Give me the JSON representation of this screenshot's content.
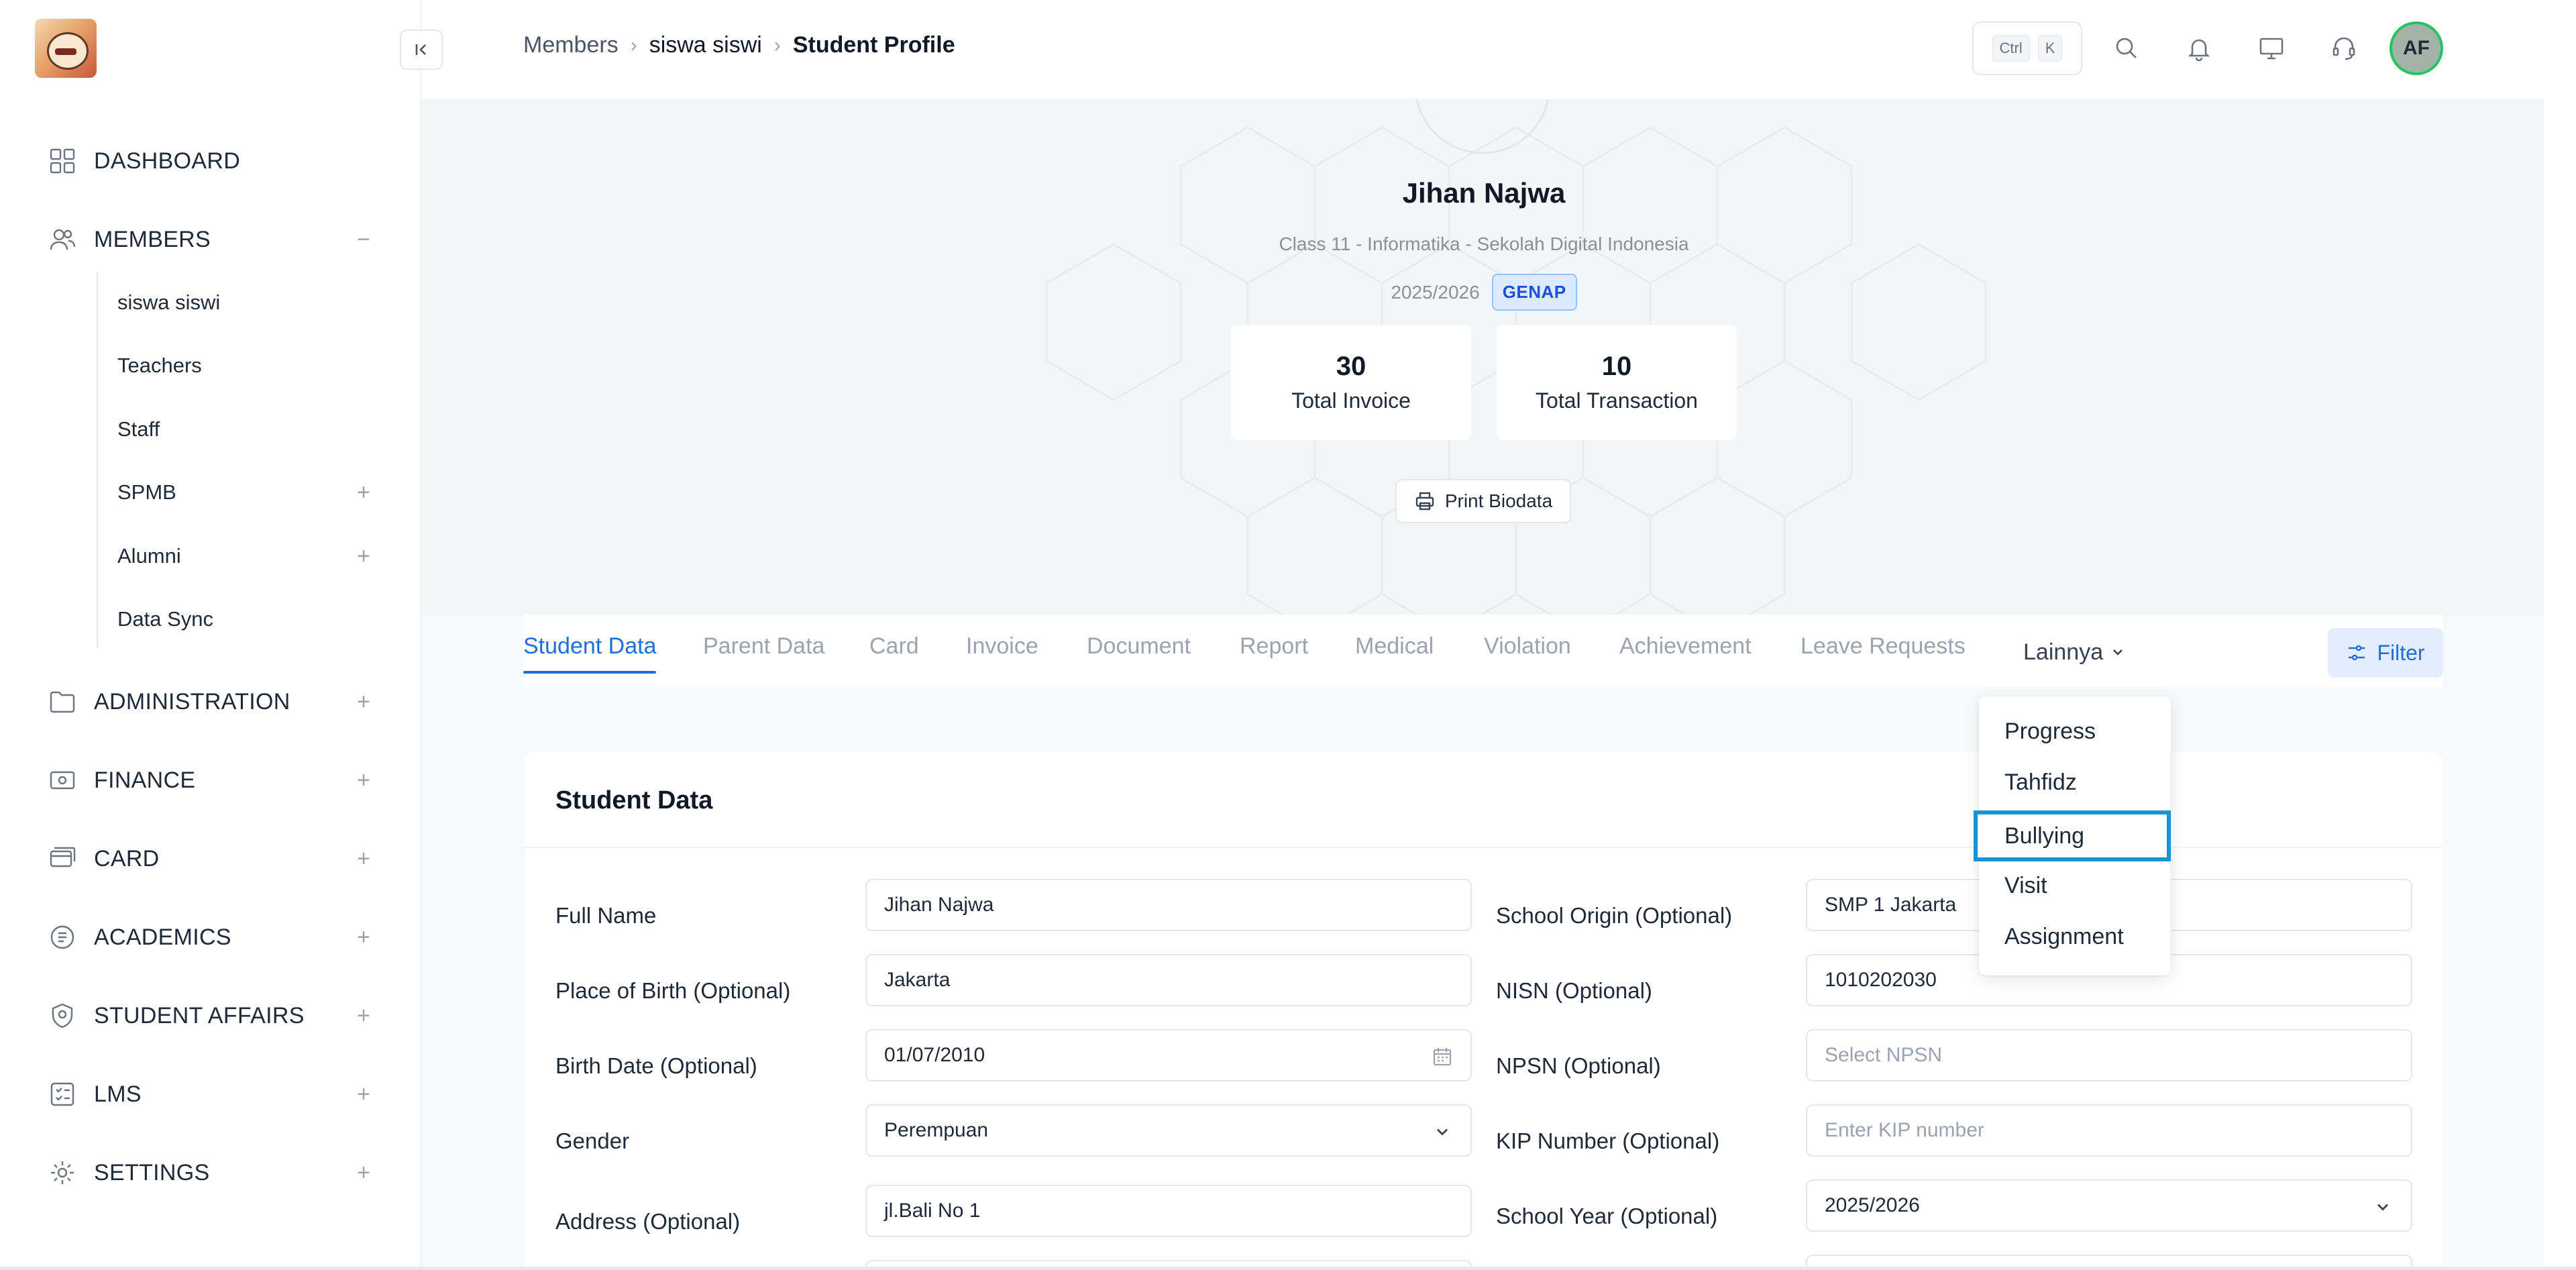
{
  "breadcrumb": {
    "first": "Members",
    "second": "siswa siswi",
    "current": "Student Profile"
  },
  "shortcut": {
    "key1": "Ctrl",
    "key2": "K"
  },
  "user": {
    "initials": "AF"
  },
  "sidebar": {
    "items": [
      {
        "label": "DASHBOARD",
        "icon": "grid-icon"
      },
      {
        "label": "MEMBERS",
        "icon": "users-icon",
        "toggle": "−"
      },
      {
        "label": "ADMINISTRATION",
        "icon": "folder-icon",
        "toggle": "+"
      },
      {
        "label": "FINANCE",
        "icon": "wallet-icon",
        "toggle": "+"
      },
      {
        "label": "CARD",
        "icon": "card-icon",
        "toggle": "+"
      },
      {
        "label": "ACADEMICS",
        "icon": "academics-icon",
        "toggle": "+"
      },
      {
        "label": "STUDENT AFFAIRS",
        "icon": "student-affairs-icon",
        "toggle": "+"
      },
      {
        "label": "LMS",
        "icon": "lms-icon",
        "toggle": "+"
      },
      {
        "label": "SETTINGS",
        "icon": "gear-icon",
        "toggle": "+"
      }
    ],
    "members_sub": [
      {
        "label": "siswa siswi"
      },
      {
        "label": "Teachers"
      },
      {
        "label": "Staff"
      },
      {
        "label": "SPMB",
        "toggle": "+"
      },
      {
        "label": "Alumni",
        "toggle": "+"
      },
      {
        "label": "Data Sync"
      }
    ]
  },
  "profile": {
    "name": "Jihan Najwa",
    "class_info": "Class 11 - Informatika - Sekolah Digital Indonesia",
    "year": "2025/2026",
    "semester_badge": "GENAP",
    "stats": [
      {
        "value": "30",
        "label": "Total Invoice"
      },
      {
        "value": "10",
        "label": "Total Transaction"
      }
    ],
    "print_label": "Print Biodata"
  },
  "tabs": [
    "Student Data",
    "Parent Data",
    "Card",
    "Invoice",
    "Document",
    "Report",
    "Medical",
    "Violation",
    "Achievement",
    "Leave Requests"
  ],
  "more_tab": "Lainnya",
  "filter_label": "Filter",
  "more_menu": [
    "Progress",
    "Tahfidz",
    "Bullying",
    "Visit",
    "Assignment"
  ],
  "form": {
    "title": "Student Data",
    "left": [
      {
        "label": "Full Name",
        "value": "Jihan Najwa"
      },
      {
        "label": "Place of Birth (Optional)",
        "value": "Jakarta"
      },
      {
        "label": "Birth Date (Optional)",
        "value": "01/07/2010"
      },
      {
        "label": "Gender",
        "value": "Perempuan"
      },
      {
        "label": "Address (Optional)",
        "value": "jl.Bali No 1"
      }
    ],
    "right": [
      {
        "label": "School Origin (Optional)",
        "value": "SMP 1 Jakarta"
      },
      {
        "label": "NISN (Optional)",
        "value": "1010202030"
      },
      {
        "label": "NPSN (Optional)",
        "placeholder": "Select NPSN"
      },
      {
        "label": "KIP Number (Optional)",
        "placeholder": "Enter KIP number"
      },
      {
        "label": "School Year (Optional)",
        "value": "2025/2026"
      }
    ]
  },
  "colors": {
    "accent": "#1e6fd9",
    "focus_ring": "#1a93d6",
    "avatar_ring": "#22c55e",
    "badge_bg": "#dbeafe"
  }
}
